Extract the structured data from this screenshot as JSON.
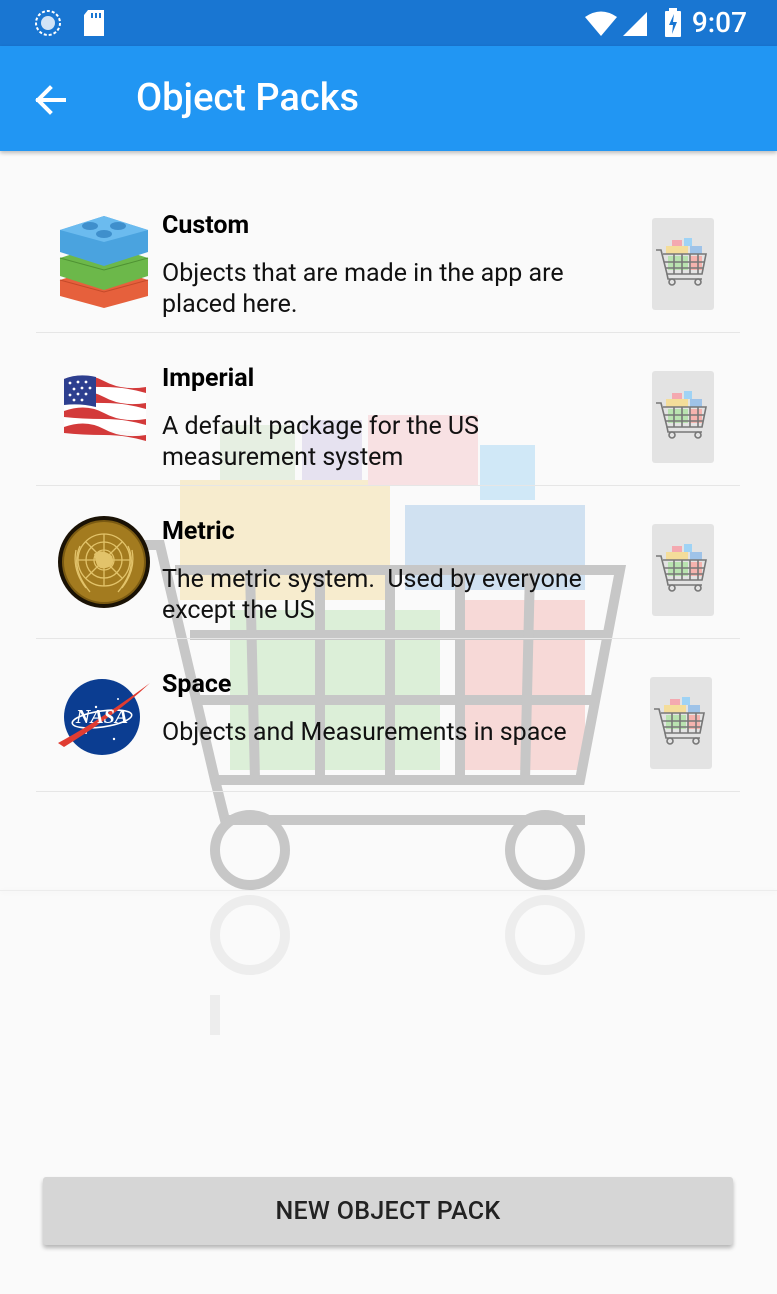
{
  "status_bar": {
    "time": "9:07"
  },
  "app_bar": {
    "title": "Object Packs"
  },
  "packs": [
    {
      "name": "Custom",
      "description": "Objects that are made in the app are placed here.",
      "icon": "lego-blocks-icon"
    },
    {
      "name": "Imperial",
      "description": "A default package for the US measurement system",
      "icon": "us-flag-icon"
    },
    {
      "name": "Metric",
      "description": "The metric system.  Used by everyone except the US",
      "icon": "un-emblem-icon"
    },
    {
      "name": "Space",
      "description": "Objects and Measurements in space",
      "icon": "nasa-logo-icon"
    }
  ],
  "new_pack_button": "NEW OBJECT PACK",
  "colors": {
    "status_bar": "#1976d2",
    "app_bar": "#2196f3",
    "background": "#fafafa",
    "button": "#d6d6d6"
  }
}
